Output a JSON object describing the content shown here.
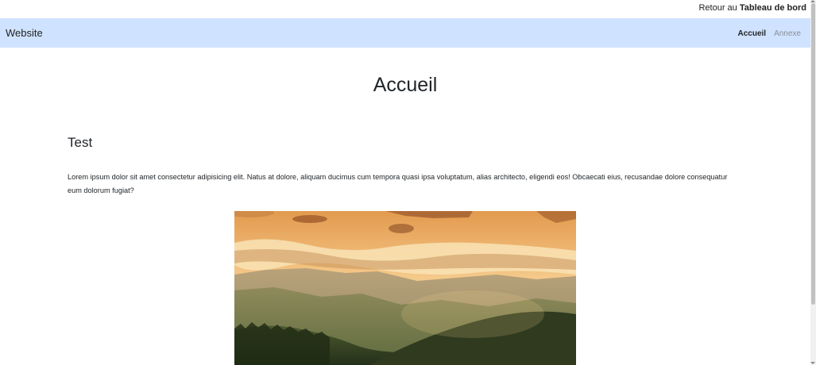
{
  "admin_bar": {
    "prefix": "Retour au",
    "link_bold": "Tableau de bord"
  },
  "navbar": {
    "brand": "Website",
    "links": [
      {
        "label": "Accueil",
        "active": true
      },
      {
        "label": "Annexe",
        "active": false
      }
    ],
    "background": "#cfe2ff"
  },
  "main": {
    "title": "Accueil",
    "section_title": "Test",
    "paragraph": "Lorem ipsum dolor sit amet consectetur adipisicing elit. Natus at dolore, aliquam ducimus cum tempora quasi ipsa voluptatum, alias architecto, eligendi eos! Obcaecati eius, recusandae dolore consequatur eum dolorum fugiat?"
  }
}
